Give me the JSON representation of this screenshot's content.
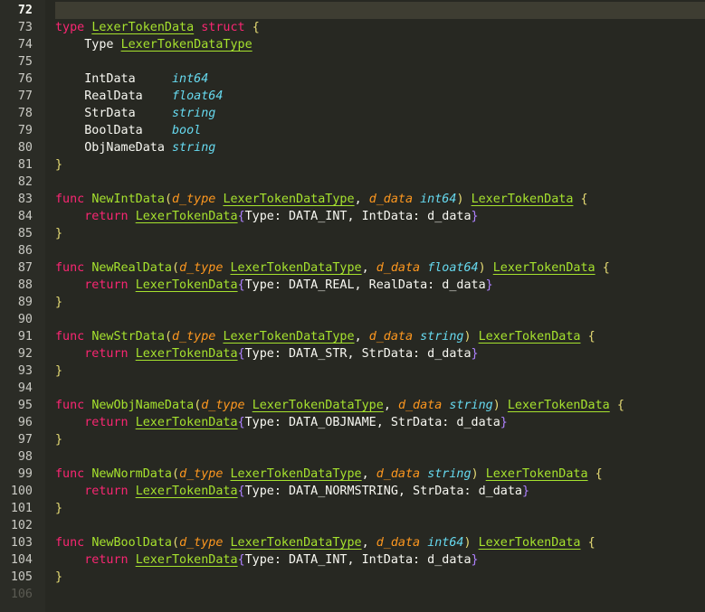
{
  "editor": {
    "lines": [
      {
        "n": "72",
        "tokens": []
      },
      {
        "n": "73",
        "tokens": [
          [
            "kw",
            "type"
          ],
          [
            "pl",
            " "
          ],
          [
            "ty",
            "LexerTokenData"
          ],
          [
            "pl",
            " "
          ],
          [
            "kw",
            "struct"
          ],
          [
            "pl",
            " "
          ],
          [
            "br",
            "{"
          ]
        ]
      },
      {
        "n": "74",
        "tokens": [
          [
            "pl",
            "    Type "
          ],
          [
            "ty",
            "LexerTokenDataType"
          ]
        ]
      },
      {
        "n": "75",
        "tokens": []
      },
      {
        "n": "76",
        "tokens": [
          [
            "pl",
            "    IntData     "
          ],
          [
            "bt",
            "int64"
          ]
        ]
      },
      {
        "n": "77",
        "tokens": [
          [
            "pl",
            "    RealData    "
          ],
          [
            "bt",
            "float64"
          ]
        ]
      },
      {
        "n": "78",
        "tokens": [
          [
            "pl",
            "    StrData     "
          ],
          [
            "bt",
            "string"
          ]
        ]
      },
      {
        "n": "79",
        "tokens": [
          [
            "pl",
            "    BoolData    "
          ],
          [
            "bt",
            "bool"
          ]
        ]
      },
      {
        "n": "80",
        "tokens": [
          [
            "pl",
            "    ObjNameData "
          ],
          [
            "bt",
            "string"
          ]
        ]
      },
      {
        "n": "81",
        "tokens": [
          [
            "br",
            "}"
          ]
        ]
      },
      {
        "n": "82",
        "tokens": []
      },
      {
        "n": "83",
        "tokens": [
          [
            "kw",
            "func"
          ],
          [
            "pl",
            " "
          ],
          [
            "fn",
            "NewIntData"
          ],
          [
            "br",
            "("
          ],
          [
            "pa",
            "d_type"
          ],
          [
            "pl",
            " "
          ],
          [
            "ty",
            "LexerTokenDataType"
          ],
          [
            "pl",
            ", "
          ],
          [
            "pa",
            "d_data"
          ],
          [
            "pl",
            " "
          ],
          [
            "bt",
            "int64"
          ],
          [
            "br",
            ")"
          ],
          [
            "pl",
            " "
          ],
          [
            "ty",
            "LexerTokenData"
          ],
          [
            "pl",
            " "
          ],
          [
            "br",
            "{"
          ]
        ]
      },
      {
        "n": "84",
        "tokens": [
          [
            "pl",
            "    "
          ],
          [
            "kw",
            "return"
          ],
          [
            "pl",
            " "
          ],
          [
            "ty",
            "LexerTokenData"
          ],
          [
            "br2",
            "{"
          ],
          [
            "pl",
            "Type: DATA_INT, IntData: d_data"
          ],
          [
            "br2",
            "}"
          ]
        ]
      },
      {
        "n": "85",
        "tokens": [
          [
            "br",
            "}"
          ]
        ]
      },
      {
        "n": "86",
        "tokens": []
      },
      {
        "n": "87",
        "tokens": [
          [
            "kw",
            "func"
          ],
          [
            "pl",
            " "
          ],
          [
            "fn",
            "NewRealData"
          ],
          [
            "br",
            "("
          ],
          [
            "pa",
            "d_type"
          ],
          [
            "pl",
            " "
          ],
          [
            "ty",
            "LexerTokenDataType"
          ],
          [
            "pl",
            ", "
          ],
          [
            "pa",
            "d_data"
          ],
          [
            "pl",
            " "
          ],
          [
            "bt",
            "float64"
          ],
          [
            "br",
            ")"
          ],
          [
            "pl",
            " "
          ],
          [
            "ty",
            "LexerTokenData"
          ],
          [
            "pl",
            " "
          ],
          [
            "br",
            "{"
          ]
        ]
      },
      {
        "n": "88",
        "tokens": [
          [
            "pl",
            "    "
          ],
          [
            "kw",
            "return"
          ],
          [
            "pl",
            " "
          ],
          [
            "ty",
            "LexerTokenData"
          ],
          [
            "br2",
            "{"
          ],
          [
            "pl",
            "Type: DATA_REAL, RealData: d_data"
          ],
          [
            "br2",
            "}"
          ]
        ]
      },
      {
        "n": "89",
        "tokens": [
          [
            "br",
            "}"
          ]
        ]
      },
      {
        "n": "90",
        "tokens": []
      },
      {
        "n": "91",
        "tokens": [
          [
            "kw",
            "func"
          ],
          [
            "pl",
            " "
          ],
          [
            "fn",
            "NewStrData"
          ],
          [
            "br",
            "("
          ],
          [
            "pa",
            "d_type"
          ],
          [
            "pl",
            " "
          ],
          [
            "ty",
            "LexerTokenDataType"
          ],
          [
            "pl",
            ", "
          ],
          [
            "pa",
            "d_data"
          ],
          [
            "pl",
            " "
          ],
          [
            "bt",
            "string"
          ],
          [
            "br",
            ")"
          ],
          [
            "pl",
            " "
          ],
          [
            "ty",
            "LexerTokenData"
          ],
          [
            "pl",
            " "
          ],
          [
            "br",
            "{"
          ]
        ]
      },
      {
        "n": "92",
        "tokens": [
          [
            "pl",
            "    "
          ],
          [
            "kw",
            "return"
          ],
          [
            "pl",
            " "
          ],
          [
            "ty",
            "LexerTokenData"
          ],
          [
            "br2",
            "{"
          ],
          [
            "pl",
            "Type: DATA_STR, StrData: d_data"
          ],
          [
            "br2",
            "}"
          ]
        ]
      },
      {
        "n": "93",
        "tokens": [
          [
            "br",
            "}"
          ]
        ]
      },
      {
        "n": "94",
        "tokens": []
      },
      {
        "n": "95",
        "tokens": [
          [
            "kw",
            "func"
          ],
          [
            "pl",
            " "
          ],
          [
            "fn",
            "NewObjNameData"
          ],
          [
            "br",
            "("
          ],
          [
            "pa",
            "d_type"
          ],
          [
            "pl",
            " "
          ],
          [
            "ty",
            "LexerTokenDataType"
          ],
          [
            "pl",
            ", "
          ],
          [
            "pa",
            "d_data"
          ],
          [
            "pl",
            " "
          ],
          [
            "bt",
            "string"
          ],
          [
            "br",
            ")"
          ],
          [
            "pl",
            " "
          ],
          [
            "ty",
            "LexerTokenData"
          ],
          [
            "pl",
            " "
          ],
          [
            "br",
            "{"
          ]
        ]
      },
      {
        "n": "96",
        "tokens": [
          [
            "pl",
            "    "
          ],
          [
            "kw",
            "return"
          ],
          [
            "pl",
            " "
          ],
          [
            "ty",
            "LexerTokenData"
          ],
          [
            "br2",
            "{"
          ],
          [
            "pl",
            "Type: DATA_OBJNAME, StrData: d_data"
          ],
          [
            "br2",
            "}"
          ]
        ]
      },
      {
        "n": "97",
        "tokens": [
          [
            "br",
            "}"
          ]
        ]
      },
      {
        "n": "98",
        "tokens": []
      },
      {
        "n": "99",
        "tokens": [
          [
            "kw",
            "func"
          ],
          [
            "pl",
            " "
          ],
          [
            "fn",
            "NewNormData"
          ],
          [
            "br",
            "("
          ],
          [
            "pa",
            "d_type"
          ],
          [
            "pl",
            " "
          ],
          [
            "ty",
            "LexerTokenDataType"
          ],
          [
            "pl",
            ", "
          ],
          [
            "pa",
            "d_data"
          ],
          [
            "pl",
            " "
          ],
          [
            "bt",
            "string"
          ],
          [
            "br",
            ")"
          ],
          [
            "pl",
            " "
          ],
          [
            "ty",
            "LexerTokenData"
          ],
          [
            "pl",
            " "
          ],
          [
            "br",
            "{"
          ]
        ]
      },
      {
        "n": "100",
        "tokens": [
          [
            "pl",
            "    "
          ],
          [
            "kw",
            "return"
          ],
          [
            "pl",
            " "
          ],
          [
            "ty",
            "LexerTokenData"
          ],
          [
            "br2",
            "{"
          ],
          [
            "pl",
            "Type: DATA_NORMSTRING, StrData: d_data"
          ],
          [
            "br2",
            "}"
          ]
        ]
      },
      {
        "n": "101",
        "tokens": [
          [
            "br",
            "}"
          ]
        ]
      },
      {
        "n": "102",
        "tokens": []
      },
      {
        "n": "103",
        "tokens": [
          [
            "kw",
            "func"
          ],
          [
            "pl",
            " "
          ],
          [
            "fn",
            "NewBoolData"
          ],
          [
            "br",
            "("
          ],
          [
            "pa",
            "d_type"
          ],
          [
            "pl",
            " "
          ],
          [
            "ty",
            "LexerTokenDataType"
          ],
          [
            "pl",
            ", "
          ],
          [
            "pa",
            "d_data"
          ],
          [
            "pl",
            " "
          ],
          [
            "bt",
            "int64"
          ],
          [
            "br",
            ")"
          ],
          [
            "pl",
            " "
          ],
          [
            "ty",
            "LexerTokenData"
          ],
          [
            "pl",
            " "
          ],
          [
            "br",
            "{"
          ]
        ]
      },
      {
        "n": "104",
        "tokens": [
          [
            "pl",
            "    "
          ],
          [
            "kw",
            "return"
          ],
          [
            "pl",
            " "
          ],
          [
            "ty",
            "LexerTokenData"
          ],
          [
            "br2",
            "{"
          ],
          [
            "pl",
            "Type: DATA_INT, IntData: d_data"
          ],
          [
            "br2",
            "}"
          ]
        ]
      },
      {
        "n": "105",
        "tokens": [
          [
            "br",
            "}"
          ]
        ]
      },
      {
        "n": "106",
        "tokens": []
      }
    ],
    "current_line": "72",
    "faded_line": "106"
  },
  "colors": {
    "background": "#272822",
    "keyword": "#f92672",
    "type": "#a6e22e",
    "builtin_type": "#66d9ef",
    "parameter": "#fd971f",
    "bracket": "#e6db74"
  }
}
